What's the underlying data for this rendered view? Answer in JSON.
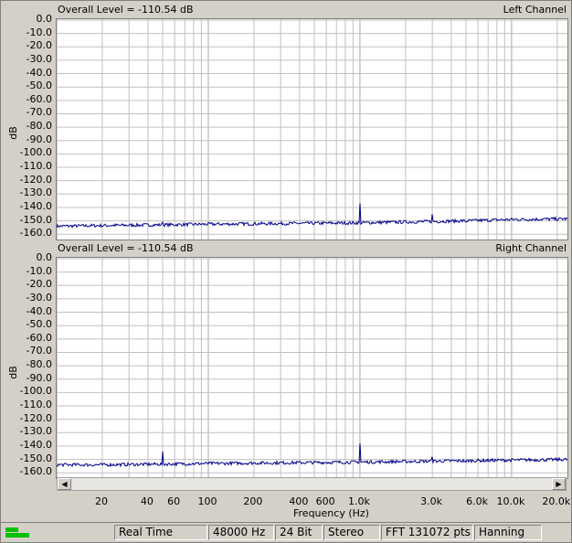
{
  "panels": [
    {
      "overall_level": "Overall Level = -110.54 dB",
      "channel": "Left Channel"
    },
    {
      "overall_level": "Overall Level = -110.54 dB",
      "channel": "Right Channel"
    }
  ],
  "y_axis_title": "dB",
  "x_axis_title": "Frequency (Hz)",
  "y_ticks": [
    "0.0",
    "-10.0",
    "-20.0",
    "-30.0",
    "-40.0",
    "-50.0",
    "-60.0",
    "-70.0",
    "-80.0",
    "-90.0",
    "-100.0",
    "-110.0",
    "-120.0",
    "-130.0",
    "-140.0",
    "-150.0",
    "-160.0"
  ],
  "x_ticks": [
    {
      "f": 20,
      "label": "20"
    },
    {
      "f": 40,
      "label": "40"
    },
    {
      "f": 60,
      "label": "60"
    },
    {
      "f": 100,
      "label": "100"
    },
    {
      "f": 200,
      "label": "200"
    },
    {
      "f": 400,
      "label": "400"
    },
    {
      "f": 600,
      "label": "600"
    },
    {
      "f": 1000,
      "label": "1.0k"
    },
    {
      "f": 3000,
      "label": "3.0k"
    },
    {
      "f": 6000,
      "label": "6.0k"
    },
    {
      "f": 10000,
      "label": "10.0k"
    },
    {
      "f": 20000,
      "label": "20.0k"
    }
  ],
  "scrollbar": {
    "left_arrow": "◀",
    "right_arrow": "▶"
  },
  "status": {
    "mode": "Real Time",
    "sample_rate": "48000 Hz",
    "bit_depth": "24 Bit",
    "channels": "Stereo",
    "fft": "FFT 131072 pts",
    "window": "Hanning"
  },
  "colors": {
    "trace": "#00008b",
    "grid": "#c0c0c0",
    "meter": "#00c000"
  },
  "chart_data": [
    {
      "type": "line",
      "title": "Left Channel",
      "xlabel": "Frequency (Hz)",
      "ylabel": "dB",
      "x_scale": "log",
      "xlim": [
        10,
        24000
      ],
      "ylim": [
        -160,
        0
      ],
      "grid": true,
      "baseline": [
        [
          10,
          -154
        ],
        [
          20,
          -153.5
        ],
        [
          50,
          -153
        ],
        [
          100,
          -152.5
        ],
        [
          1000,
          -151.5
        ],
        [
          5000,
          -150
        ],
        [
          10000,
          -149
        ],
        [
          24000,
          -148.5
        ]
      ],
      "peaks": [
        [
          50,
          -151
        ],
        [
          150,
          -153
        ],
        [
          1000,
          -137
        ],
        [
          3000,
          -145
        ],
        [
          5000,
          -151
        ]
      ]
    },
    {
      "type": "line",
      "title": "Right Channel",
      "xlabel": "Frequency (Hz)",
      "ylabel": "dB",
      "x_scale": "log",
      "xlim": [
        10,
        24000
      ],
      "ylim": [
        -160,
        0
      ],
      "grid": true,
      "baseline": [
        [
          10,
          -154
        ],
        [
          20,
          -154
        ],
        [
          50,
          -153.5
        ],
        [
          100,
          -153
        ],
        [
          1000,
          -152
        ],
        [
          5000,
          -151
        ],
        [
          10000,
          -150.5
        ],
        [
          24000,
          -150
        ]
      ],
      "peaks": [
        [
          50,
          -144
        ],
        [
          250,
          -153
        ],
        [
          1000,
          -138
        ],
        [
          3000,
          -148
        ],
        [
          5000,
          -152
        ]
      ]
    }
  ]
}
